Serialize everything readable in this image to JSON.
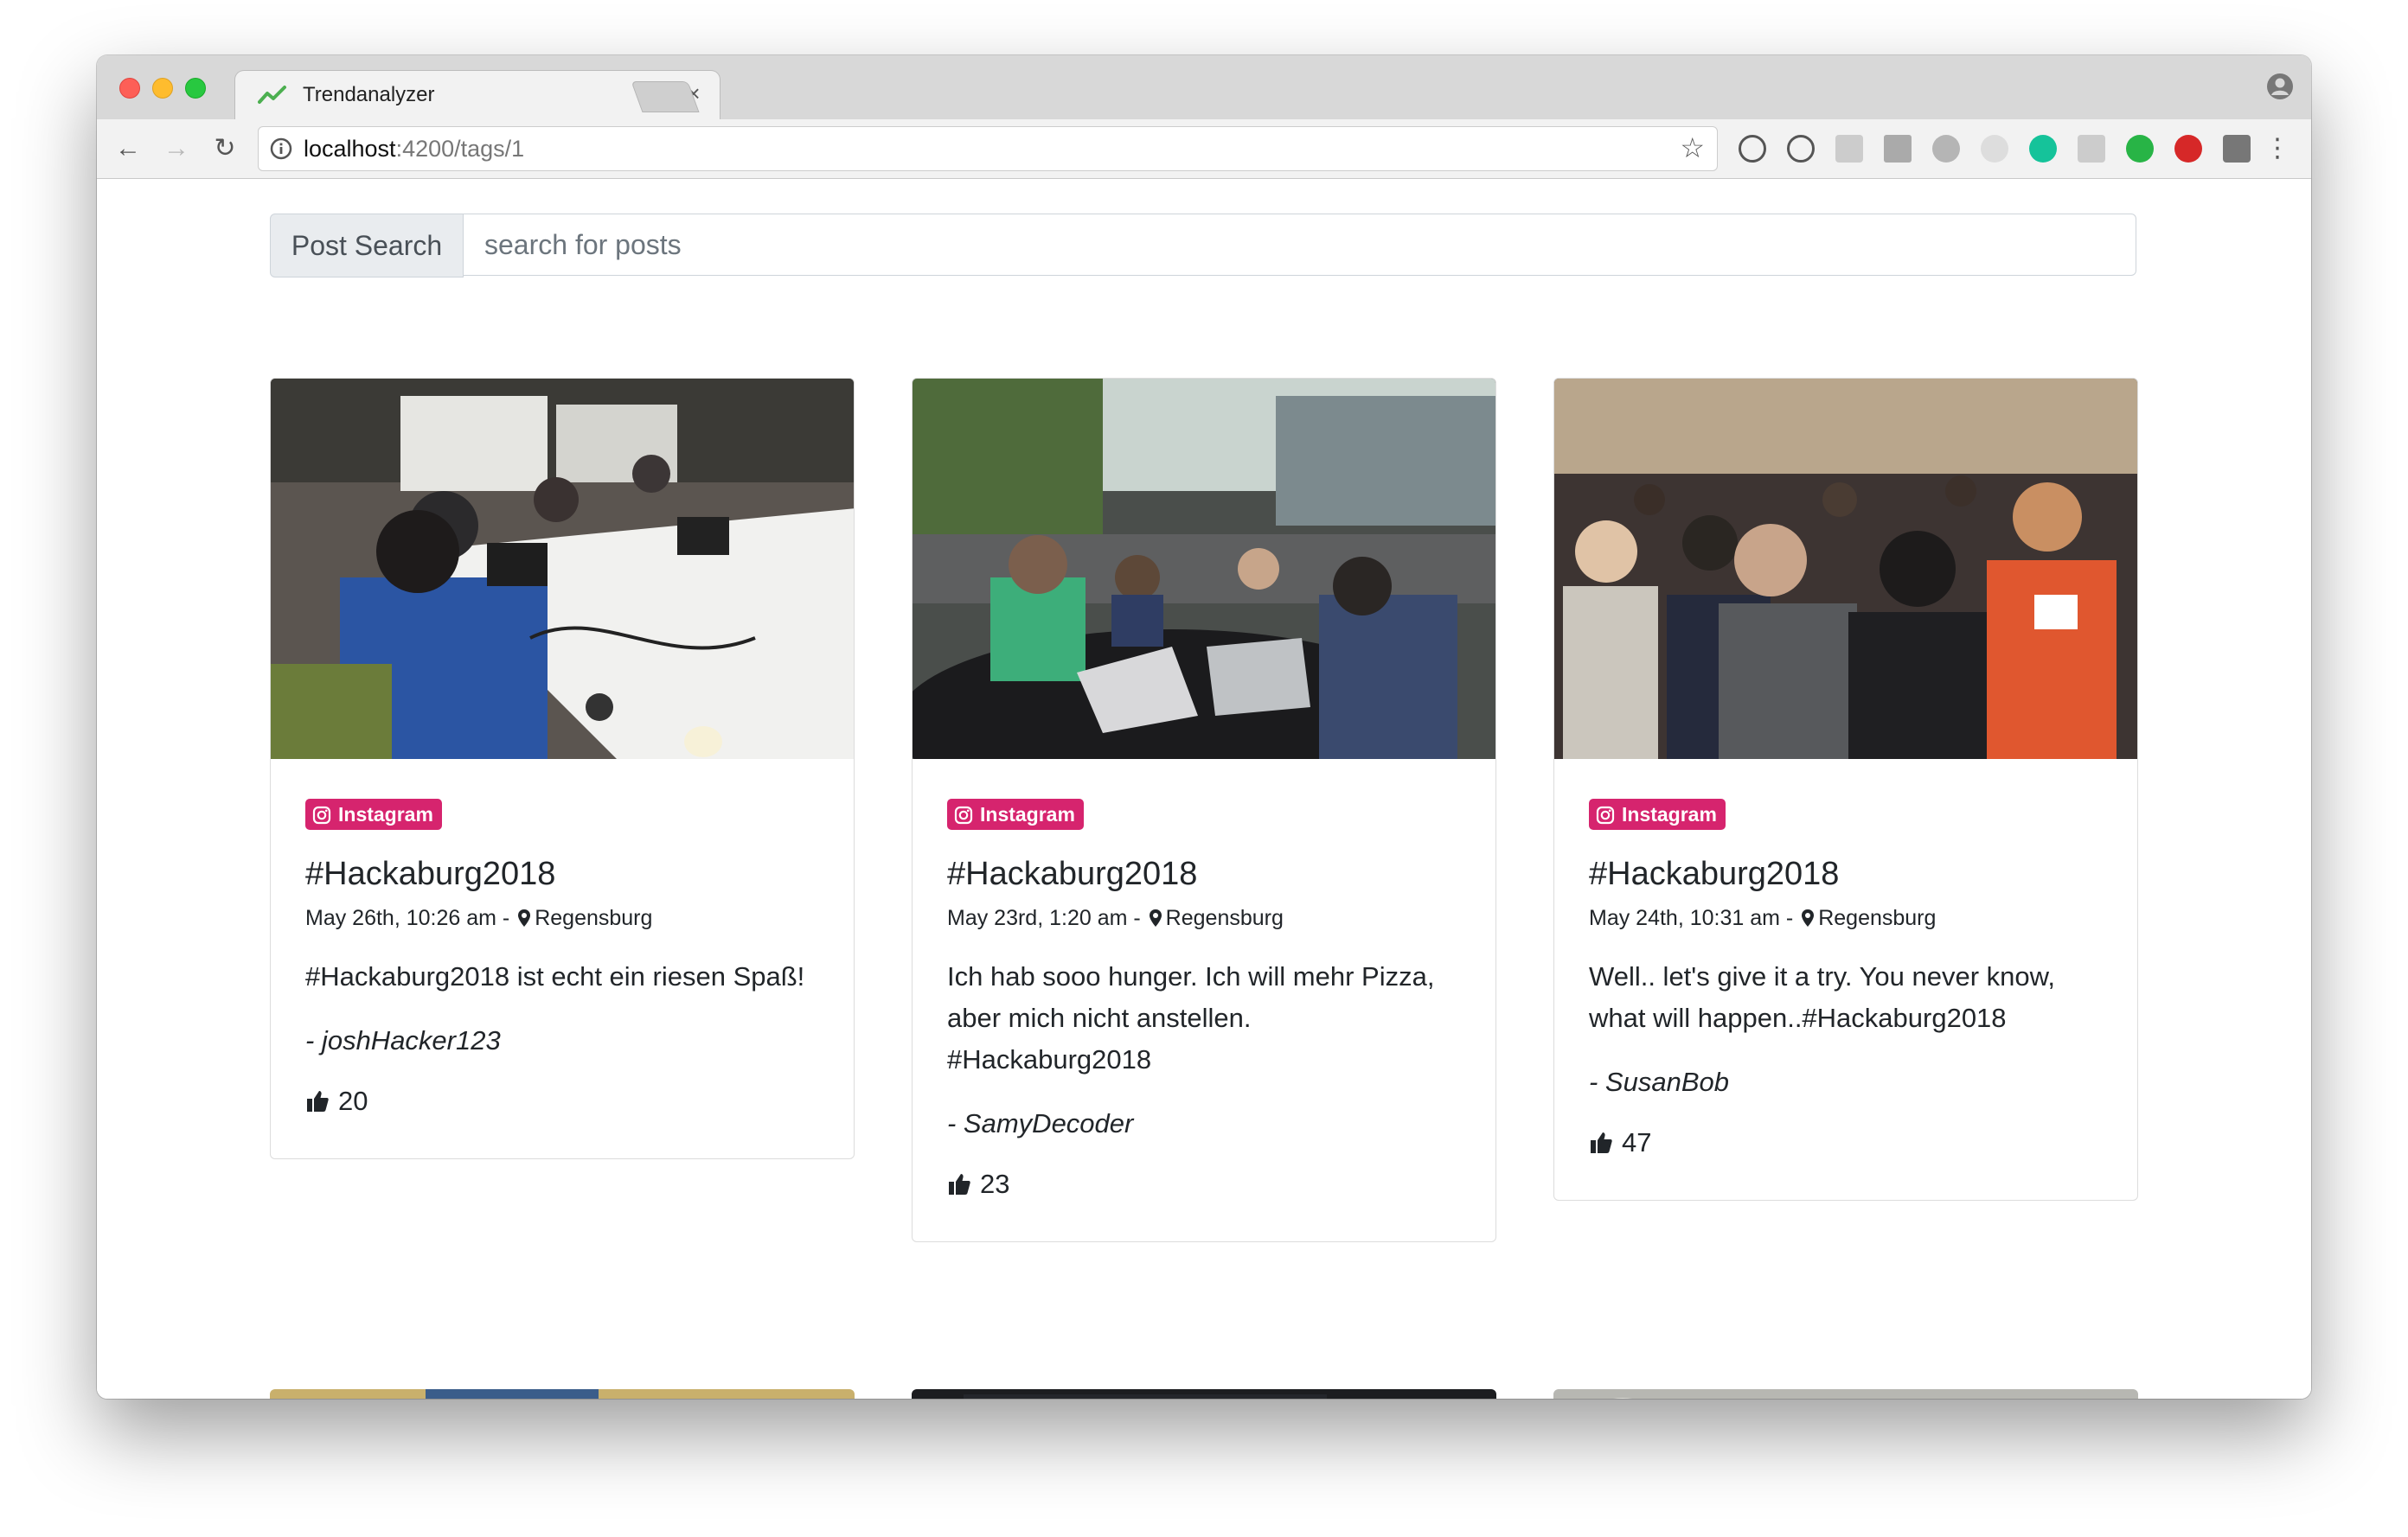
{
  "browser": {
    "tab_title": "Trendanalyzer",
    "url_host": "localhost",
    "url_path": ":4200/tags/1",
    "tab_close": "×",
    "menu": "⋮"
  },
  "search": {
    "label": "Post Search",
    "placeholder": "search for posts"
  },
  "posts": [
    {
      "badge": "Instagram",
      "title": "#Hackaburg2018",
      "date": "May 26th, 10:26 am",
      "separator": "-",
      "location": "Regensburg",
      "text": "#Hackaburg2018 ist echt ein riesen Spaß!",
      "author": "- joshHacker123",
      "likes": "20"
    },
    {
      "badge": "Instagram",
      "title": "#Hackaburg2018",
      "date": "May 23rd, 1:20 am",
      "separator": "-",
      "location": "Regensburg",
      "text": "Ich hab sooo hunger. Ich will mehr Pizza, aber mich nicht anstellen. #Hackaburg2018",
      "author": "- SamyDecoder",
      "likes": "23"
    },
    {
      "badge": "Instagram",
      "title": "#Hackaburg2018",
      "date": "May 24th, 10:31 am",
      "separator": "-",
      "location": "Regensburg",
      "text": "Well.. let's give it a try. You never know, what will happen..#Hackaburg2018",
      "author": "- SusanBob",
      "likes": "47"
    }
  ],
  "colors": {
    "instagram_badge": "#d6246e",
    "input_addon_bg": "#e9ecef"
  }
}
